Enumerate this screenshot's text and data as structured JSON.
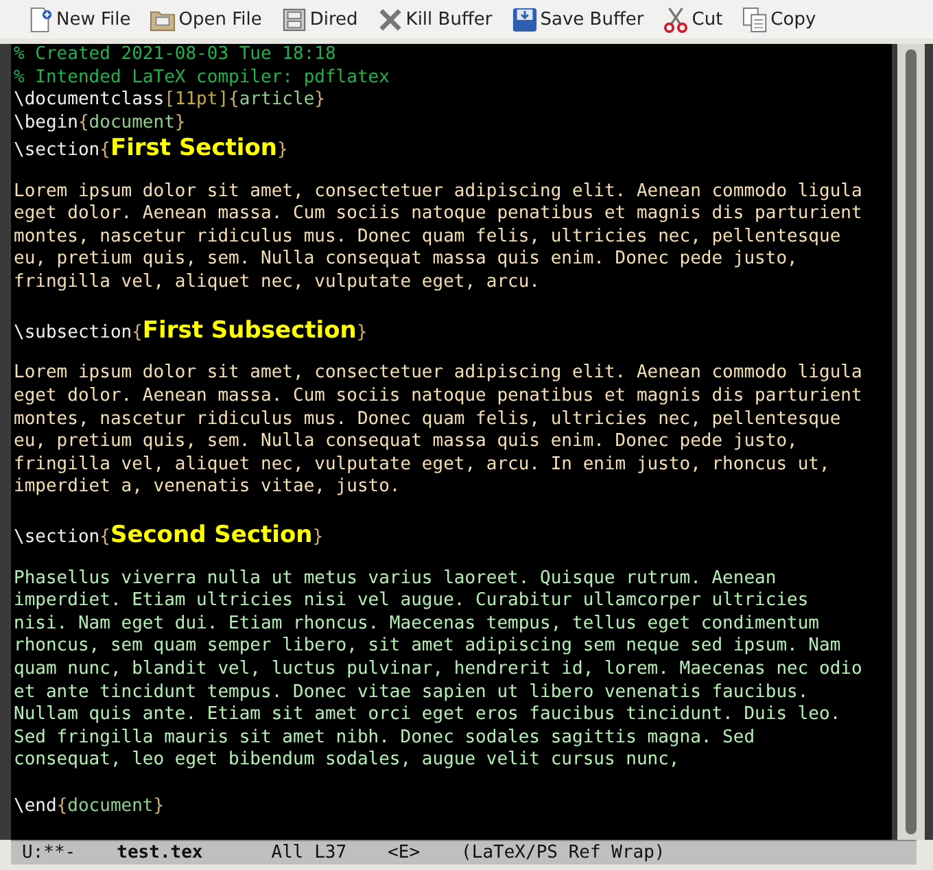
{
  "toolbar": [
    {
      "label": "New File"
    },
    {
      "label": "Open File"
    },
    {
      "label": "Dired"
    },
    {
      "label": "Kill Buffer"
    },
    {
      "label": "Save Buffer"
    },
    {
      "label": "Cut"
    },
    {
      "label": "Copy"
    }
  ],
  "editor": {
    "blocks": [
      {
        "kind": "code",
        "segments": [
          {
            "kind": "comment",
            "text": "% Created 2021-08-03 Tue 18:18"
          }
        ]
      },
      {
        "kind": "code",
        "segments": [
          {
            "kind": "comment",
            "text": "% Intended LaTeX compiler: pdflatex"
          }
        ]
      },
      {
        "kind": "code",
        "segments": [
          {
            "kind": "command",
            "text": "\\documentclass"
          },
          {
            "kind": "option",
            "text": "[11pt]"
          },
          {
            "kind": "brace",
            "text": "{"
          },
          {
            "kind": "argument",
            "text": "article"
          },
          {
            "kind": "brace",
            "text": "}"
          }
        ]
      },
      {
        "kind": "code",
        "segments": [
          {
            "kind": "command",
            "text": "\\begin"
          },
          {
            "kind": "brace",
            "text": "{"
          },
          {
            "kind": "argument",
            "text": "document"
          },
          {
            "kind": "brace",
            "text": "}"
          }
        ]
      },
      {
        "kind": "code",
        "segments": [
          {
            "kind": "command",
            "text": "\\section"
          },
          {
            "kind": "brace",
            "text": "{"
          },
          {
            "kind": "title",
            "text": "First Section"
          },
          {
            "kind": "brace",
            "text": "}"
          }
        ]
      },
      {
        "kind": "blank"
      },
      {
        "kind": "paragraph",
        "color": "#f5deb3",
        "lines": [
          "Lorem ipsum dolor sit amet, consectetuer adipiscing elit. Aenean commodo ligula",
          "eget dolor. Aenean massa. Cum sociis natoque penatibus et magnis dis parturient",
          "montes, nascetur ridiculus mus. Donec quam felis, ultricies nec, pellentesque",
          "eu, pretium quis, sem. Nulla consequat massa quis enim. Donec pede justo,",
          "fringilla vel, aliquet nec, vulputate eget, arcu."
        ]
      },
      {
        "kind": "blank"
      },
      {
        "kind": "code",
        "segments": [
          {
            "kind": "command",
            "text": "\\subsection"
          },
          {
            "kind": "brace",
            "text": "{"
          },
          {
            "kind": "title",
            "text": "First Subsection"
          },
          {
            "kind": "brace",
            "text": "}"
          }
        ]
      },
      {
        "kind": "blank"
      },
      {
        "kind": "paragraph",
        "color": "#f5deb3",
        "lines": [
          "Lorem ipsum dolor sit amet, consectetuer adipiscing elit. Aenean commodo ligula",
          "eget dolor. Aenean massa. Cum sociis natoque penatibus et magnis dis parturient",
          "montes, nascetur ridiculus mus. Donec quam felis, ultricies nec, pellentesque",
          "eu, pretium quis, sem. Nulla consequat massa quis enim. Donec pede justo,",
          "fringilla vel, aliquet nec, vulputate eget, arcu. In enim justo, rhoncus ut,",
          "imperdiet a, venenatis vitae, justo."
        ]
      },
      {
        "kind": "blank"
      },
      {
        "kind": "code",
        "segments": [
          {
            "kind": "command",
            "text": "\\section"
          },
          {
            "kind": "brace",
            "text": "{"
          },
          {
            "kind": "title",
            "text": "Second Section"
          },
          {
            "kind": "brace",
            "text": "}"
          }
        ]
      },
      {
        "kind": "blank"
      },
      {
        "kind": "paragraph",
        "color": "#b4eeb4",
        "lines": [
          "Phasellus viverra nulla ut metus varius laoreet. Quisque rutrum. Aenean",
          "imperdiet. Etiam ultricies nisi vel augue. Curabitur ullamcorper ultricies",
          "nisi. Nam eget dui. Etiam rhoncus. Maecenas tempus, tellus eget condimentum",
          "rhoncus, sem quam semper libero, sit amet adipiscing sem neque sed ipsum. Nam",
          "quam nunc, blandit vel, luctus pulvinar, hendrerit id, lorem. Maecenas nec odio",
          "et ante tincidunt tempus. Donec vitae sapien ut libero venenatis faucibus.",
          "Nullam quis ante. Etiam sit amet orci eget eros faucibus tincidunt. Duis leo.",
          "Sed fringilla mauris sit amet nibh. Donec sodales sagittis magna. Sed",
          "consequat, leo eget bibendum sodales, augue velit cursus nunc,"
        ]
      },
      {
        "kind": "blank"
      },
      {
        "kind": "code",
        "segments": [
          {
            "kind": "command",
            "text": "\\end"
          },
          {
            "kind": "brace",
            "text": "{"
          },
          {
            "kind": "argument",
            "text": "document"
          },
          {
            "kind": "brace",
            "text": "}"
          }
        ]
      }
    ]
  },
  "mode_line": {
    "status": "U:**-",
    "buffer": "test.tex",
    "position": "All L37",
    "state": "<E>",
    "modes": "(LaTeX/PS Ref Wrap)"
  }
}
